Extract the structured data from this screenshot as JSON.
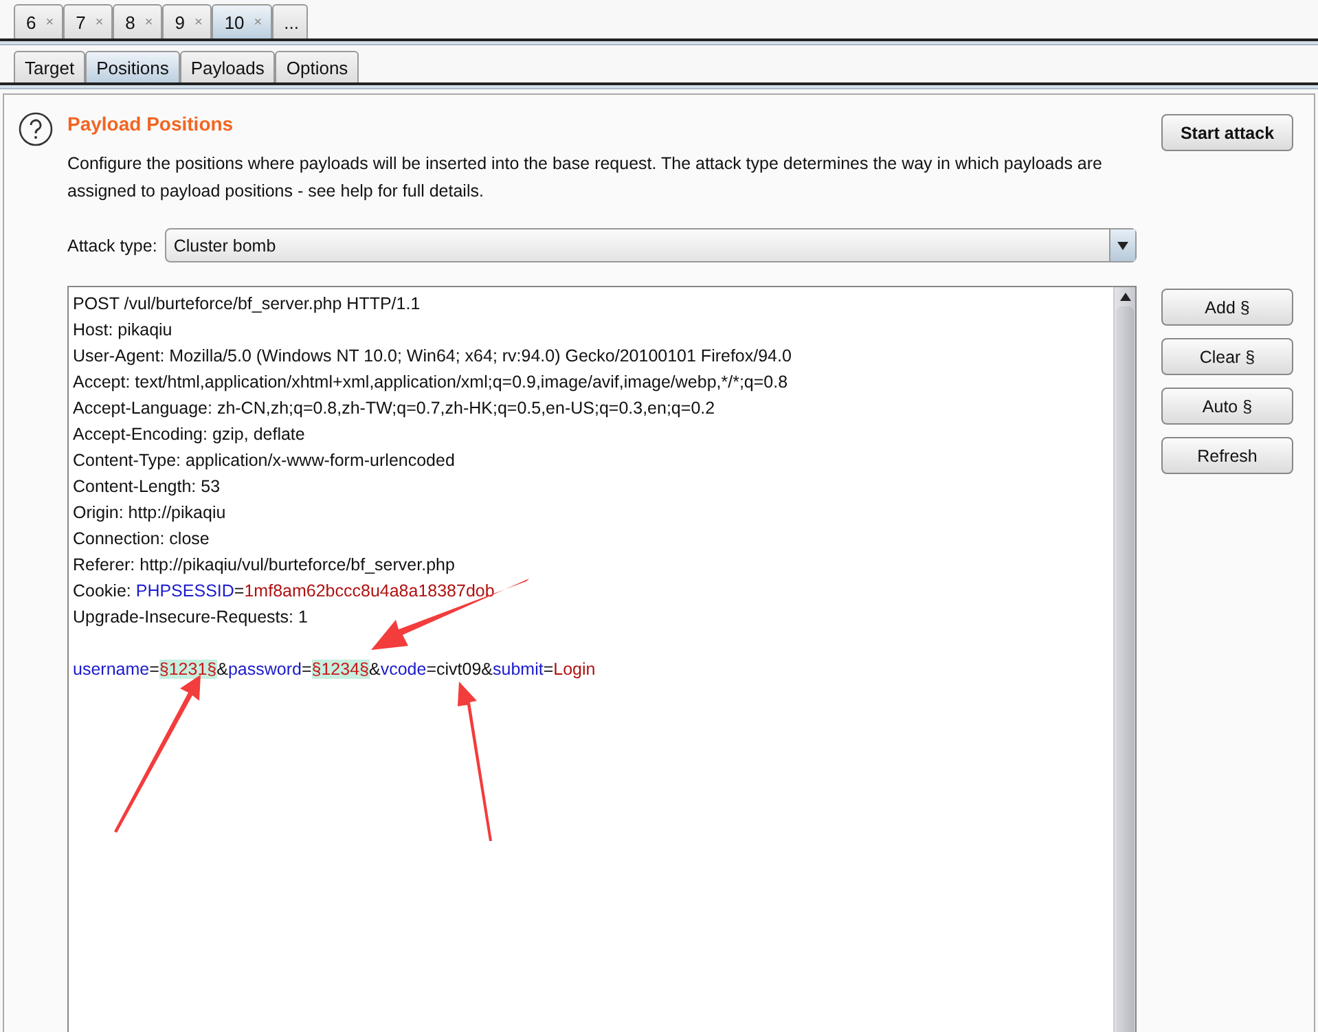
{
  "request_tabs": [
    {
      "label": "6",
      "close": "×",
      "selected": false
    },
    {
      "label": "7",
      "close": "×",
      "selected": false
    },
    {
      "label": "8",
      "close": "×",
      "selected": false
    },
    {
      "label": "9",
      "close": "×",
      "selected": false
    },
    {
      "label": "10",
      "close": "×",
      "selected": true
    },
    {
      "label": "...",
      "selected": false
    }
  ],
  "tabs": [
    {
      "label": "Target",
      "selected": false
    },
    {
      "label": "Positions",
      "selected": true
    },
    {
      "label": "Payloads",
      "selected": false
    },
    {
      "label": "Options",
      "selected": false
    }
  ],
  "section": {
    "title": "Payload Positions",
    "description": "Configure the positions where payloads will be inserted into the base request. The attack type determines the way in which payloads are assigned to payload positions - see help for full details.",
    "start_button": "Start attack"
  },
  "attack_type": {
    "label": "Attack type:",
    "value": "Cluster bomb"
  },
  "request": {
    "headers": [
      [
        {
          "kind": "plain",
          "text": "POST /vul/burteforce/bf_server.php HTTP/1.1"
        }
      ],
      [
        {
          "kind": "plain",
          "text": "Host: pikaqiu"
        }
      ],
      [
        {
          "kind": "plain",
          "text": "User-Agent: Mozilla/5.0 (Windows NT 10.0; Win64; x64; rv:94.0) Gecko/20100101 Firefox/94.0"
        }
      ],
      [
        {
          "kind": "plain",
          "text": "Accept: text/html,application/xhtml+xml,application/xml;q=0.9,image/avif,image/webp,*/*;q=0.8"
        }
      ],
      [
        {
          "kind": "plain",
          "text": "Accept-Language: zh-CN,zh;q=0.8,zh-TW;q=0.7,zh-HK;q=0.5,en-US;q=0.3,en;q=0.2"
        }
      ],
      [
        {
          "kind": "plain",
          "text": "Accept-Encoding: gzip, deflate"
        }
      ],
      [
        {
          "kind": "plain",
          "text": "Content-Type: application/x-www-form-urlencoded"
        }
      ],
      [
        {
          "kind": "plain",
          "text": "Content-Length: 53"
        }
      ],
      [
        {
          "kind": "plain",
          "text": "Origin: http://pikaqiu"
        }
      ],
      [
        {
          "kind": "plain",
          "text": "Connection: close"
        }
      ],
      [
        {
          "kind": "plain",
          "text": "Referer: http://pikaqiu/vul/burteforce/bf_server.php"
        }
      ],
      [
        {
          "kind": "plain",
          "text": "Cookie: "
        },
        {
          "kind": "name",
          "text": "PHPSESSID"
        },
        {
          "kind": "plain",
          "text": "="
        },
        {
          "kind": "value",
          "text": "1mf8am62bccc8u4a8a18387dob"
        }
      ],
      [
        {
          "kind": "plain",
          "text": "Upgrade-Insecure-Requests: 1"
        }
      ]
    ],
    "body": [
      {
        "kind": "name",
        "text": "username"
      },
      {
        "kind": "plain",
        "text": "="
      },
      {
        "kind": "payload",
        "text": "§1231§"
      },
      {
        "kind": "plain",
        "text": "&"
      },
      {
        "kind": "name",
        "text": "password"
      },
      {
        "kind": "plain",
        "text": "="
      },
      {
        "kind": "payload",
        "text": "§1234§"
      },
      {
        "kind": "plain",
        "text": "&"
      },
      {
        "kind": "name",
        "text": "vcode"
      },
      {
        "kind": "plain",
        "text": "=civt09&"
      },
      {
        "kind": "name",
        "text": "submit"
      },
      {
        "kind": "plain",
        "text": "="
      },
      {
        "kind": "value",
        "text": "Login"
      }
    ]
  },
  "side_buttons": [
    "Add §",
    "Clear §",
    "Auto §",
    "Refresh"
  ]
}
